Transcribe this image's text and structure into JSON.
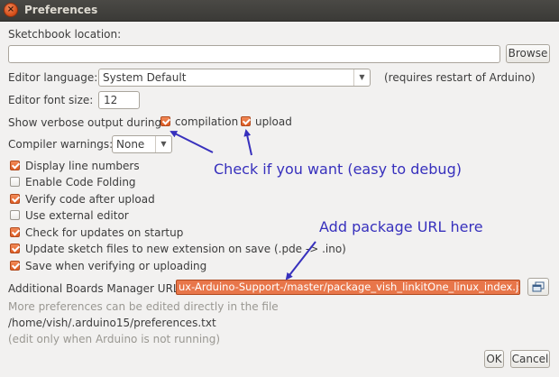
{
  "window": {
    "title": "Preferences",
    "close_glyph": "×"
  },
  "sketchbook": {
    "label": "Sketchbook location:",
    "value": "",
    "browse_label": "Browse"
  },
  "editor_language": {
    "label": "Editor language:",
    "selected": "System Default",
    "note": "(requires restart of Arduino)"
  },
  "font_size": {
    "label": "Editor font size:",
    "value": "12"
  },
  "verbose": {
    "label": "Show verbose output during:",
    "compilation_label": "compilation",
    "compilation_checked": true,
    "upload_label": "upload",
    "upload_checked": true
  },
  "compiler_warnings": {
    "label": "Compiler warnings:",
    "selected": "None"
  },
  "options": [
    {
      "label": "Display line numbers",
      "checked": true
    },
    {
      "label": "Enable Code Folding",
      "checked": false
    },
    {
      "label": "Verify code after upload",
      "checked": true
    },
    {
      "label": "Use external editor",
      "checked": false
    },
    {
      "label": "Check for updates on startup",
      "checked": true
    },
    {
      "label": "Update sketch files to new extension on save (.pde -> .ino)",
      "checked": true
    },
    {
      "label": "Save when verifying or uploading",
      "checked": true
    }
  ],
  "boards_manager": {
    "label": "Additional Boards Manager URLs:",
    "value": "ux-Arduino-Support-/master/package_vish_linkitOne_linux_index.json",
    "window_icon": "window-icon"
  },
  "footer": {
    "more_prefs": "More preferences can be edited directly in the file",
    "path": "/home/vish/.arduino15/preferences.txt",
    "edit_note": "(edit only when Arduino is not running)",
    "ok_label": "OK",
    "cancel_label": "Cancel"
  },
  "annotations": {
    "check_text": "Check if you want (easy to debug)",
    "url_text": "Add package URL here",
    "color": "#3730bd"
  },
  "colors": {
    "accent": "#df5e24",
    "titlebar": "#3b3a37",
    "background": "#f2f1f0"
  }
}
